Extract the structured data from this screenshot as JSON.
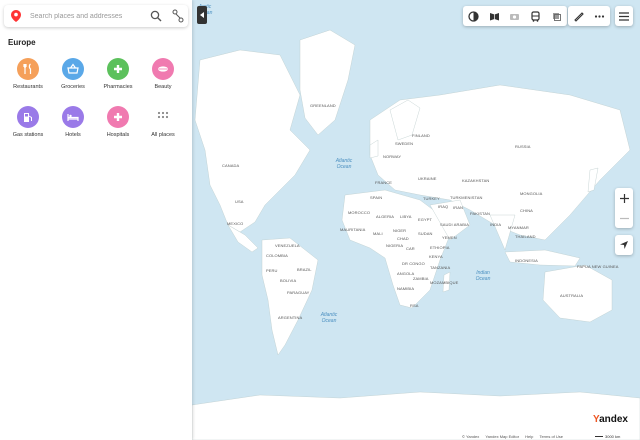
{
  "search": {
    "placeholder": "Search places and addresses"
  },
  "sidebar": {
    "region_title": "Europe",
    "categories": [
      {
        "label": "Restaurants",
        "icon": "fork-knife-icon",
        "color": "#f5a05a"
      },
      {
        "label": "Groceries",
        "icon": "basket-icon",
        "color": "#5aa8e8"
      },
      {
        "label": "Pharmacies",
        "icon": "plus-icon",
        "color": "#5cc15c"
      },
      {
        "label": "Beauty",
        "icon": "lips-icon",
        "color": "#f07ab0"
      },
      {
        "label": "Gas stations",
        "icon": "fuel-icon",
        "color": "#9a7ae8"
      },
      {
        "label": "Hotels",
        "icon": "bed-icon",
        "color": "#9a7ae8"
      },
      {
        "label": "Hospitals",
        "icon": "cross-icon",
        "color": "#f07ab0"
      },
      {
        "label": "All places",
        "icon": "grid-dots-icon",
        "color": "#ffffff"
      }
    ]
  },
  "map": {
    "oceans": [
      {
        "text": "Arctic Ocean"
      },
      {
        "text": "Atlantic Ocean"
      },
      {
        "text": "Atlantic Ocean"
      },
      {
        "text": "Indian Ocean"
      }
    ],
    "countries": [
      "GREENLAND",
      "CANADA",
      "USA",
      "MEXICO",
      "VENEZUELA",
      "COLOMBIA",
      "PERU",
      "BRAZIL",
      "BOLIVIA",
      "PARAGUAY",
      "ARGENTINA",
      "SWEDEN",
      "FINLAND",
      "NORWAY",
      "RUSSIA",
      "FRANCE",
      "SPAIN",
      "UKRAINE",
      "KAZAKHSTAN",
      "TURKEY",
      "TURKMENISTAN",
      "IRAQ",
      "IRAN",
      "MOROCCO",
      "ALGERIA",
      "LIBYA",
      "EGYPT",
      "SAUDI ARABIA",
      "PAKISTAN",
      "MAURITANIA",
      "MALI",
      "NIGER",
      "CHAD",
      "SUDAN",
      "YEMEN",
      "INDIA",
      "CHINA",
      "MONGOLIA",
      "MYANMAR",
      "THAILAND",
      "INDONESIA",
      "NIGERIA",
      "CAR",
      "ETHIOPIA",
      "KENYA",
      "DR CONGO",
      "TANZANIA",
      "ANGOLA",
      "ZAMBIA",
      "MOZAMBIQUE",
      "NAMIBIA",
      "RSA",
      "AUSTRALIA",
      "PAPUA NEW GUINEA"
    ]
  },
  "footer": {
    "links": [
      "© Yandex",
      "Yandex Map Editor",
      "Help",
      "Terms of Use"
    ],
    "scale": "3000 km"
  },
  "brand": {
    "first": "Y",
    "rest": "andex"
  }
}
